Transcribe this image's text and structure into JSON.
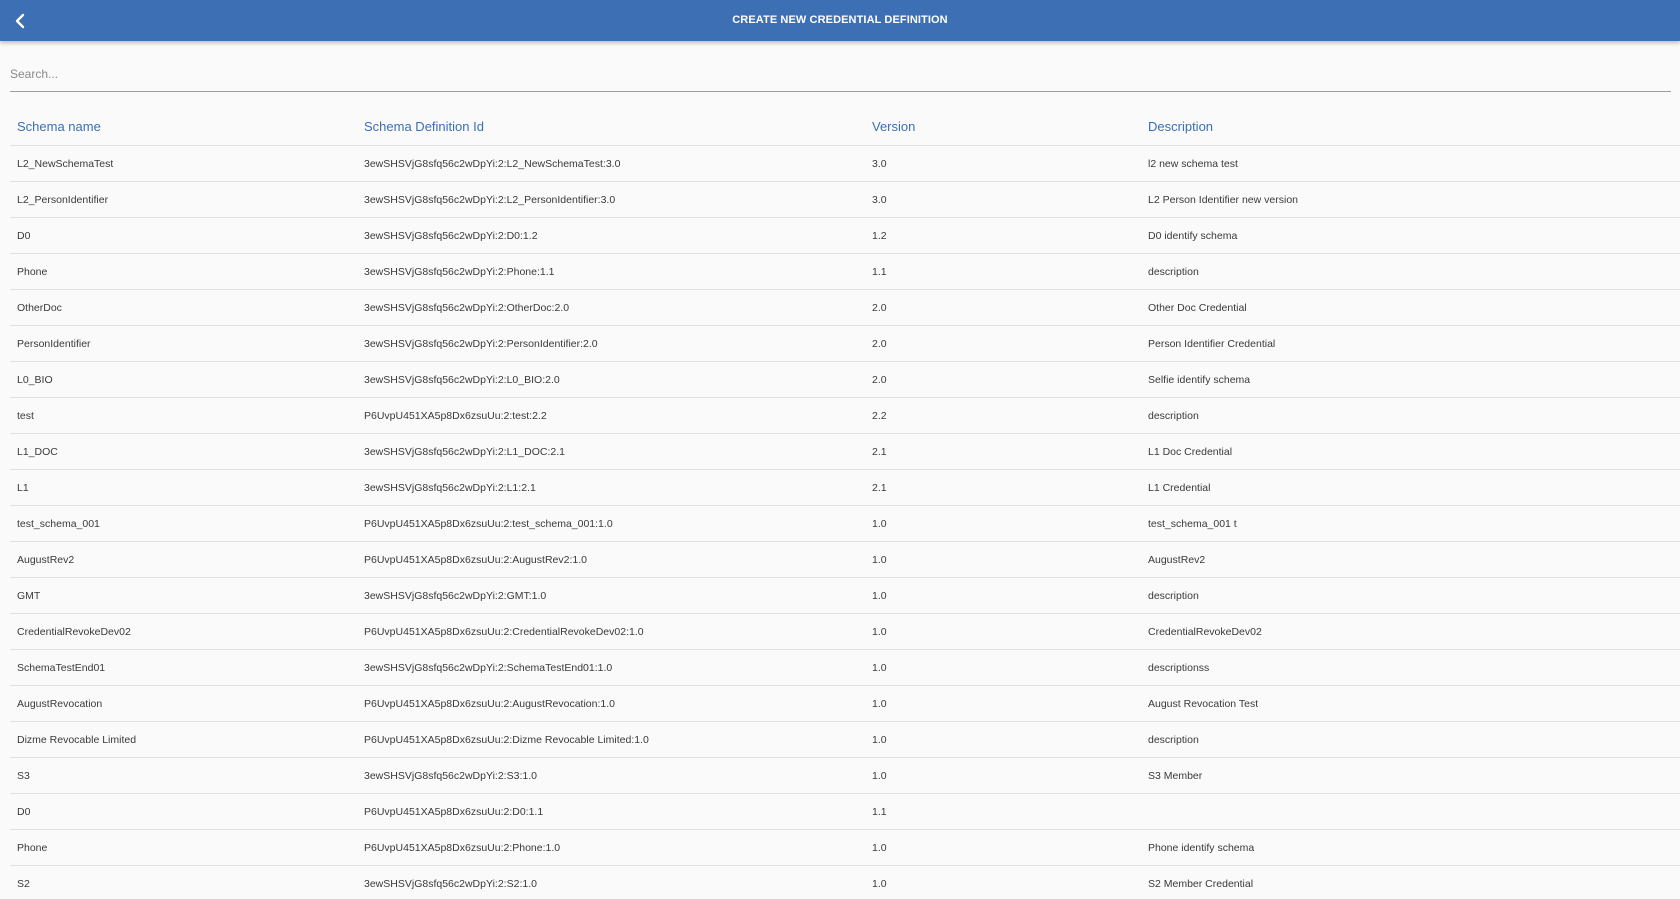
{
  "header": {
    "title": "CREATE NEW CREDENTIAL DEFINITION",
    "back_icon": "chevron-left-icon",
    "background_color": "#3c6fb4"
  },
  "search": {
    "placeholder": "Search...",
    "value": ""
  },
  "table": {
    "columns": [
      "Schema name",
      "Schema Definition Id",
      "Version",
      "Description"
    ],
    "rows": [
      [
        "L2_NewSchemaTest",
        "3ewSHSVjG8sfq56c2wDpYi:2:L2_NewSchemaTest:3.0",
        "3.0",
        "l2 new schema test"
      ],
      [
        "L2_PersonIdentifier",
        "3ewSHSVjG8sfq56c2wDpYi:2:L2_PersonIdentifier:3.0",
        "3.0",
        "L2 Person Identifier new version"
      ],
      [
        "D0",
        "3ewSHSVjG8sfq56c2wDpYi:2:D0:1.2",
        "1.2",
        "D0 identify schema"
      ],
      [
        "Phone",
        "3ewSHSVjG8sfq56c2wDpYi:2:Phone:1.1",
        "1.1",
        "description"
      ],
      [
        "OtherDoc",
        "3ewSHSVjG8sfq56c2wDpYi:2:OtherDoc:2.0",
        "2.0",
        "Other Doc Credential"
      ],
      [
        "PersonIdentifier",
        "3ewSHSVjG8sfq56c2wDpYi:2:PersonIdentifier:2.0",
        "2.0",
        "Person Identifier Credential"
      ],
      [
        "L0_BIO",
        "3ewSHSVjG8sfq56c2wDpYi:2:L0_BIO:2.0",
        "2.0",
        "Selfie identify schema"
      ],
      [
        "test",
        "P6UvpU451XA5p8Dx6zsuUu:2:test:2.2",
        "2.2",
        "description"
      ],
      [
        "L1_DOC",
        "3ewSHSVjG8sfq56c2wDpYi:2:L1_DOC:2.1",
        "2.1",
        "L1 Doc Credential"
      ],
      [
        "L1",
        "3ewSHSVjG8sfq56c2wDpYi:2:L1:2.1",
        "2.1",
        "L1 Credential"
      ],
      [
        "test_schema_001",
        "P6UvpU451XA5p8Dx6zsuUu:2:test_schema_001:1.0",
        "1.0",
        "test_schema_001 t"
      ],
      [
        "AugustRev2",
        "P6UvpU451XA5p8Dx6zsuUu:2:AugustRev2:1.0",
        "1.0",
        "AugustRev2"
      ],
      [
        "GMT",
        "3ewSHSVjG8sfq56c2wDpYi:2:GMT:1.0",
        "1.0",
        "description"
      ],
      [
        "CredentialRevokeDev02",
        "P6UvpU451XA5p8Dx6zsuUu:2:CredentialRevokeDev02:1.0",
        "1.0",
        "CredentialRevokeDev02"
      ],
      [
        "SchemaTestEnd01",
        "3ewSHSVjG8sfq56c2wDpYi:2:SchemaTestEnd01:1.0",
        "1.0",
        "descriptionss"
      ],
      [
        "AugustRevocation",
        "P6UvpU451XA5p8Dx6zsuUu:2:AugustRevocation:1.0",
        "1.0",
        "August Revocation Test"
      ],
      [
        "Dizme Revocable Limited",
        "P6UvpU451XA5p8Dx6zsuUu:2:Dizme Revocable Limited:1.0",
        "1.0",
        "description"
      ],
      [
        "S3",
        "3ewSHSVjG8sfq56c2wDpYi:2:S3:1.0",
        "1.0",
        "S3 Member"
      ],
      [
        "D0",
        "P6UvpU451XA5p8Dx6zsuUu:2:D0:1.1",
        "1.1",
        ""
      ],
      [
        "Phone",
        "P6UvpU451XA5p8Dx6zsuUu:2:Phone:1.0",
        "1.0",
        "Phone identify schema"
      ],
      [
        "S2",
        "3ewSHSVjG8sfq56c2wDpYi:2:S2:1.0",
        "1.0",
        "S2 Member Credential"
      ]
    ]
  }
}
